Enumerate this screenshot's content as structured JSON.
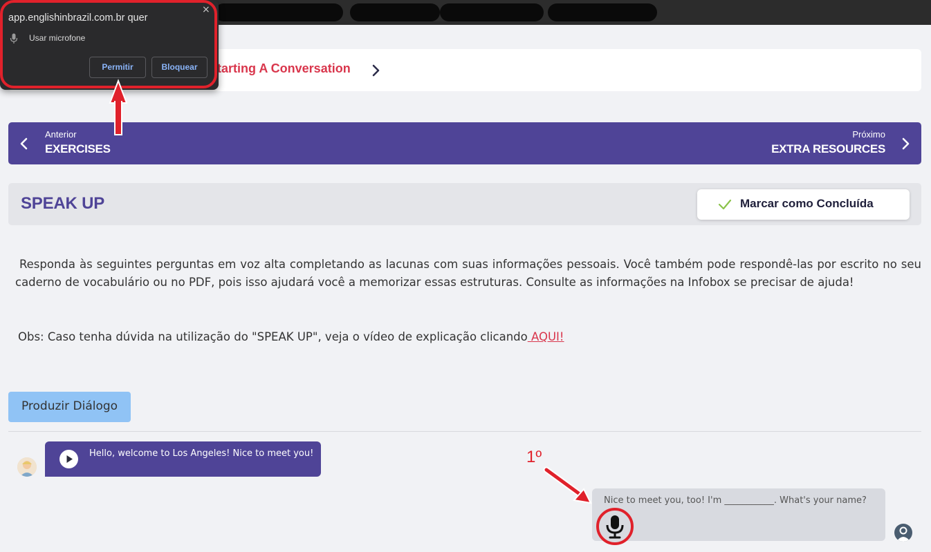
{
  "permission_popup": {
    "title": "app.englishinbrazil.com.br quer",
    "request": "Usar microfone",
    "allow_label": "Permitir",
    "block_label": "Bloquear",
    "close_glyph": "×"
  },
  "breadcrumb": {
    "lesson": "Starting A Conversation"
  },
  "nav": {
    "prev_small": "Anterior",
    "prev_label": "EXERCISES",
    "next_small": "Próximo",
    "next_label": "EXTRA RESOURCES"
  },
  "section": {
    "title": "SPEAK UP",
    "mark_done_label": "Marcar como Concluída"
  },
  "content": {
    "instructions": "Responda às seguintes perguntas em voz alta completando as lacunas com suas informações pessoais. Você também pode respondê-las por escrito no seu caderno de vocabulário ou no PDF, pois isso ajudará você a memorizar essas estruturas. Consulte as informações na Infobox se precisar de ajuda!",
    "obs_text": "Obs: Caso tenha dúvida na utilização do \"SPEAK UP\", veja o vídeo de explicação clicando",
    "obs_link": " AQUI!"
  },
  "dialog": {
    "produce_button": "Produzir Diálogo",
    "step_label": "1º",
    "messages": [
      {
        "side": "left",
        "text": "Hello, welcome to Los Angeles! Nice to meet you!"
      },
      {
        "side": "right",
        "text": "Nice to meet you, too! I'm ___________. What's your name?"
      }
    ]
  },
  "colors": {
    "brand_purple": "#4f4497",
    "accent_red": "#d9364c",
    "annotation_red": "#e0212b",
    "check_green": "#8bc34a",
    "produce_blue": "#90c3f5"
  },
  "icons": [
    "microphone-icon",
    "chevron-right-icon",
    "chevron-left-icon",
    "check-icon",
    "play-icon",
    "close-icon",
    "user-avatar-icon"
  ]
}
